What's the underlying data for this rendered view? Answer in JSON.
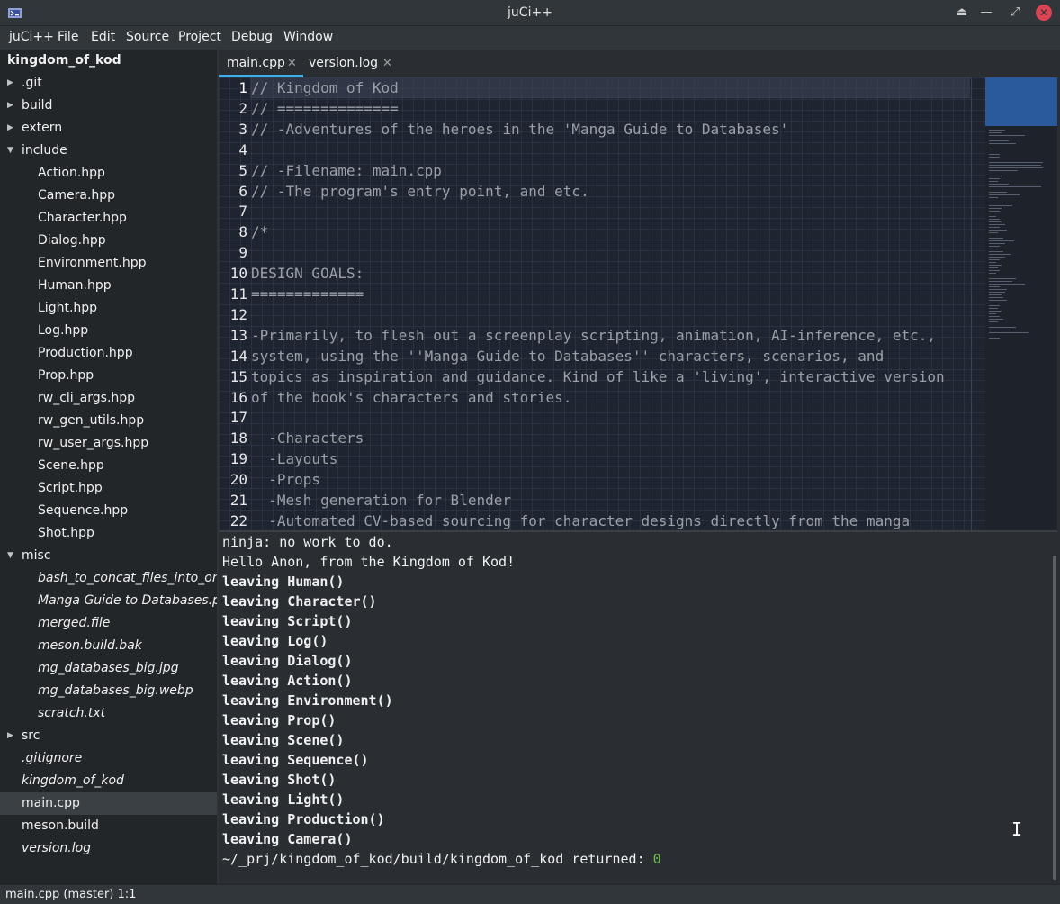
{
  "window": {
    "title": "juCi++"
  },
  "menu": [
    "juCi++",
    "File",
    "Edit",
    "Source",
    "Project",
    "Debug",
    "Window"
  ],
  "sidebar": {
    "root": "kingdom_of_kod",
    "items": [
      {
        "label": ".git",
        "type": "folder",
        "expanded": false,
        "depth": 0
      },
      {
        "label": "build",
        "type": "folder",
        "expanded": false,
        "depth": 0
      },
      {
        "label": "extern",
        "type": "folder",
        "expanded": false,
        "depth": 0
      },
      {
        "label": "include",
        "type": "folder",
        "expanded": true,
        "depth": 0
      },
      {
        "label": "Action.hpp",
        "type": "file",
        "depth": 1
      },
      {
        "label": "Camera.hpp",
        "type": "file",
        "depth": 1
      },
      {
        "label": "Character.hpp",
        "type": "file",
        "depth": 1
      },
      {
        "label": "Dialog.hpp",
        "type": "file",
        "depth": 1
      },
      {
        "label": "Environment.hpp",
        "type": "file",
        "depth": 1
      },
      {
        "label": "Human.hpp",
        "type": "file",
        "depth": 1
      },
      {
        "label": "Light.hpp",
        "type": "file",
        "depth": 1
      },
      {
        "label": "Log.hpp",
        "type": "file",
        "depth": 1
      },
      {
        "label": "Production.hpp",
        "type": "file",
        "depth": 1
      },
      {
        "label": "Prop.hpp",
        "type": "file",
        "depth": 1
      },
      {
        "label": "rw_cli_args.hpp",
        "type": "file",
        "depth": 1
      },
      {
        "label": "rw_gen_utils.hpp",
        "type": "file",
        "depth": 1
      },
      {
        "label": "rw_user_args.hpp",
        "type": "file",
        "depth": 1
      },
      {
        "label": "Scene.hpp",
        "type": "file",
        "depth": 1
      },
      {
        "label": "Script.hpp",
        "type": "file",
        "depth": 1
      },
      {
        "label": "Sequence.hpp",
        "type": "file",
        "depth": 1
      },
      {
        "label": "Shot.hpp",
        "type": "file",
        "depth": 1
      },
      {
        "label": "misc",
        "type": "folder",
        "expanded": true,
        "depth": 0
      },
      {
        "label": "bash_to_concat_files_into_one",
        "type": "file",
        "italic": true,
        "depth": 1
      },
      {
        "label": "Manga Guide to Databases.pdf",
        "type": "file",
        "italic": true,
        "depth": 1
      },
      {
        "label": "merged.file",
        "type": "file",
        "italic": true,
        "depth": 1
      },
      {
        "label": "meson.build.bak",
        "type": "file",
        "italic": true,
        "depth": 1
      },
      {
        "label": "mg_databases_big.jpg",
        "type": "file",
        "italic": true,
        "depth": 1
      },
      {
        "label": "mg_databases_big.webp",
        "type": "file",
        "italic": true,
        "depth": 1
      },
      {
        "label": "scratch.txt",
        "type": "file",
        "italic": true,
        "depth": 1
      },
      {
        "label": "src",
        "type": "folder",
        "expanded": false,
        "depth": 0
      },
      {
        "label": ".gitignore",
        "type": "file",
        "italic": true,
        "depth": 0
      },
      {
        "label": "kingdom_of_kod",
        "type": "file",
        "italic": true,
        "depth": 0
      },
      {
        "label": "main.cpp",
        "type": "file",
        "selected": true,
        "depth": 0
      },
      {
        "label": "meson.build",
        "type": "file",
        "depth": 0
      },
      {
        "label": "version.log",
        "type": "file",
        "italic": true,
        "depth": 0
      }
    ]
  },
  "tabs": [
    {
      "label": "main.cpp",
      "active": true
    },
    {
      "label": "version.log",
      "active": false
    }
  ],
  "editor": {
    "current_line": 1,
    "lines": [
      "// Kingdom of Kod",
      "// ==============",
      "// -Adventures of the heroes in the 'Manga Guide to Databases'",
      "",
      "// -Filename: main.cpp",
      "// -The program's entry point, and etc.",
      "",
      "/*",
      "",
      "DESIGN GOALS:",
      "=============",
      "",
      "-Primarily, to flesh out a screenplay scripting, animation, AI-inference, etc.,",
      "system, using the ''Manga Guide to Databases'' characters, scenarios, and",
      "topics as inspiration and guidance. Kind of like a 'living', interactive version",
      "of the book's characters and stories.",
      "",
      "  -Characters",
      "  -Layouts",
      "  -Props",
      "  -Mesh generation for Blender",
      "  -Automated CV-based sourcing for character designs directly from the manga"
    ]
  },
  "terminal": {
    "lines": [
      {
        "text": "ninja: no work to do.",
        "bold": false
      },
      {
        "text": "Hello Anon, from the Kingdom of Kod!",
        "bold": false
      },
      {
        "text": "leaving Human()",
        "bold": true
      },
      {
        "text": "leaving Character()",
        "bold": true
      },
      {
        "text": "leaving Script()",
        "bold": true
      },
      {
        "text": "leaving Log()",
        "bold": true
      },
      {
        "text": "leaving Dialog()",
        "bold": true
      },
      {
        "text": "leaving Action()",
        "bold": true
      },
      {
        "text": "leaving Environment()",
        "bold": true
      },
      {
        "text": "leaving Prop()",
        "bold": true
      },
      {
        "text": "leaving Scene()",
        "bold": true
      },
      {
        "text": "leaving Sequence()",
        "bold": true
      },
      {
        "text": "leaving Shot()",
        "bold": true
      },
      {
        "text": "leaving Light()",
        "bold": true
      },
      {
        "text": "leaving Production()",
        "bold": true
      },
      {
        "text": "leaving Camera()",
        "bold": true
      }
    ],
    "return_prefix": "~/_prj/kingdom_of_kod/build/kingdom_of_kod returned: ",
    "return_code": "0"
  },
  "statusbar": {
    "text": "main.cpp (master) 1:1"
  },
  "colors": {
    "accent": "#3daee9",
    "close": "#da4453",
    "return_code": "#6fbf4a"
  }
}
